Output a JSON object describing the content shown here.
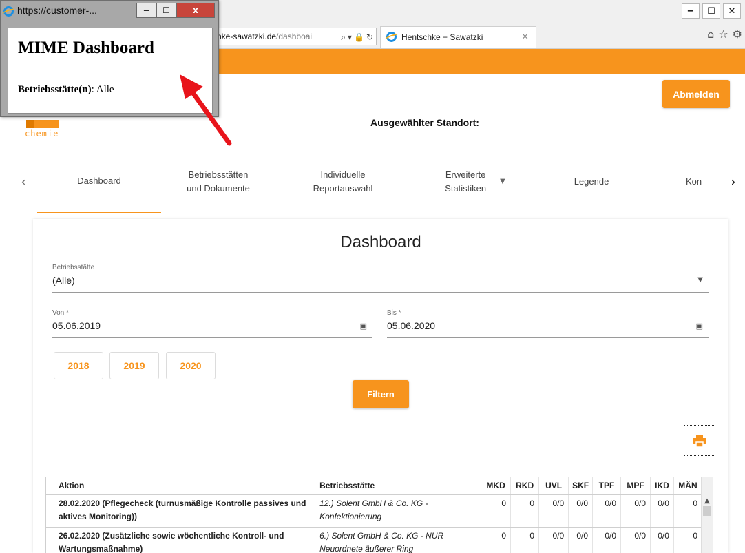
{
  "browser": {
    "address_domain": "hke-sawatzki.de",
    "address_path": "/dashboai",
    "tab_title": "Hentschke + Sawatzki",
    "tab_close": "×",
    "window_controls": [
      "−",
      "☐",
      "✕"
    ],
    "address_tools": [
      "⌕",
      "▾",
      "🔒",
      "↻"
    ],
    "toolbar_icons": [
      "⌂",
      "☆",
      "⚙"
    ]
  },
  "popup": {
    "title": "https://customer-...",
    "controls": [
      "−",
      "☐",
      "x"
    ],
    "heading": "MIME Dashboard",
    "line_key": "Betriebsstätte(n)",
    "line_sep": ": ",
    "line_value": "Alle"
  },
  "header": {
    "logo_text": "chemie",
    "logout_label": "Abmelden",
    "location_label": "Ausgewählter Standort:"
  },
  "nav": {
    "prev_icon": "‹",
    "next_icon": "›",
    "tabs": [
      {
        "label": "Dashboard"
      },
      {
        "label_1": "Betriebsstätten",
        "label_2": "und Dokumente"
      },
      {
        "label_1": "Individuelle",
        "label_2": "Reportauswahl"
      },
      {
        "label_1": "Erweiterte",
        "label_2": "Statistiken",
        "dropdown": "▼"
      },
      {
        "label": "Legende"
      },
      {
        "label": "Kon"
      }
    ]
  },
  "dashboard": {
    "title": "Dashboard",
    "betriebsstaette": {
      "label": "Betriebsstätte",
      "value": "(Alle)",
      "dropdown": "▼"
    },
    "von": {
      "label": "Von *",
      "value": "05.06.2019",
      "icon": "▣"
    },
    "bis": {
      "label": "Bis *",
      "value": "05.06.2020",
      "icon": "▣"
    },
    "year_buttons": [
      "2018",
      "2019",
      "2020"
    ],
    "filter_label": "Filtern"
  },
  "table": {
    "headers": [
      "Aktion",
      "Betriebsstätte",
      "MKD",
      "RKD",
      "UVL",
      "SKF",
      "TPF",
      "MPF",
      "IKD",
      "MÄN"
    ],
    "rows": [
      {
        "aktion": "28.02.2020 (Pflegecheck (turnusmäßige Kontrolle passives und aktives Monitoring))",
        "stelle": "12.) Solent GmbH & Co. KG - Konfektionierung",
        "values": [
          "0",
          "0",
          "0/0",
          "0/0",
          "0/0",
          "0/0",
          "0/0",
          "0"
        ]
      },
      {
        "aktion": "26.02.2020 (Zusätzliche sowie wöchentliche Kontroll- und Wartungsmaßnahme)",
        "stelle": "6.) Solent GmbH & Co. KG - NUR Neuordnete äußerer Ring",
        "values": [
          "0",
          "0",
          "0/0",
          "0/0",
          "0/0",
          "0/0",
          "0/0",
          "0"
        ]
      }
    ],
    "scroll_up": "▲"
  },
  "colors": {
    "accent": "#f7941d",
    "arrow": "#e8141b",
    "popup_close": "#c8453b"
  }
}
